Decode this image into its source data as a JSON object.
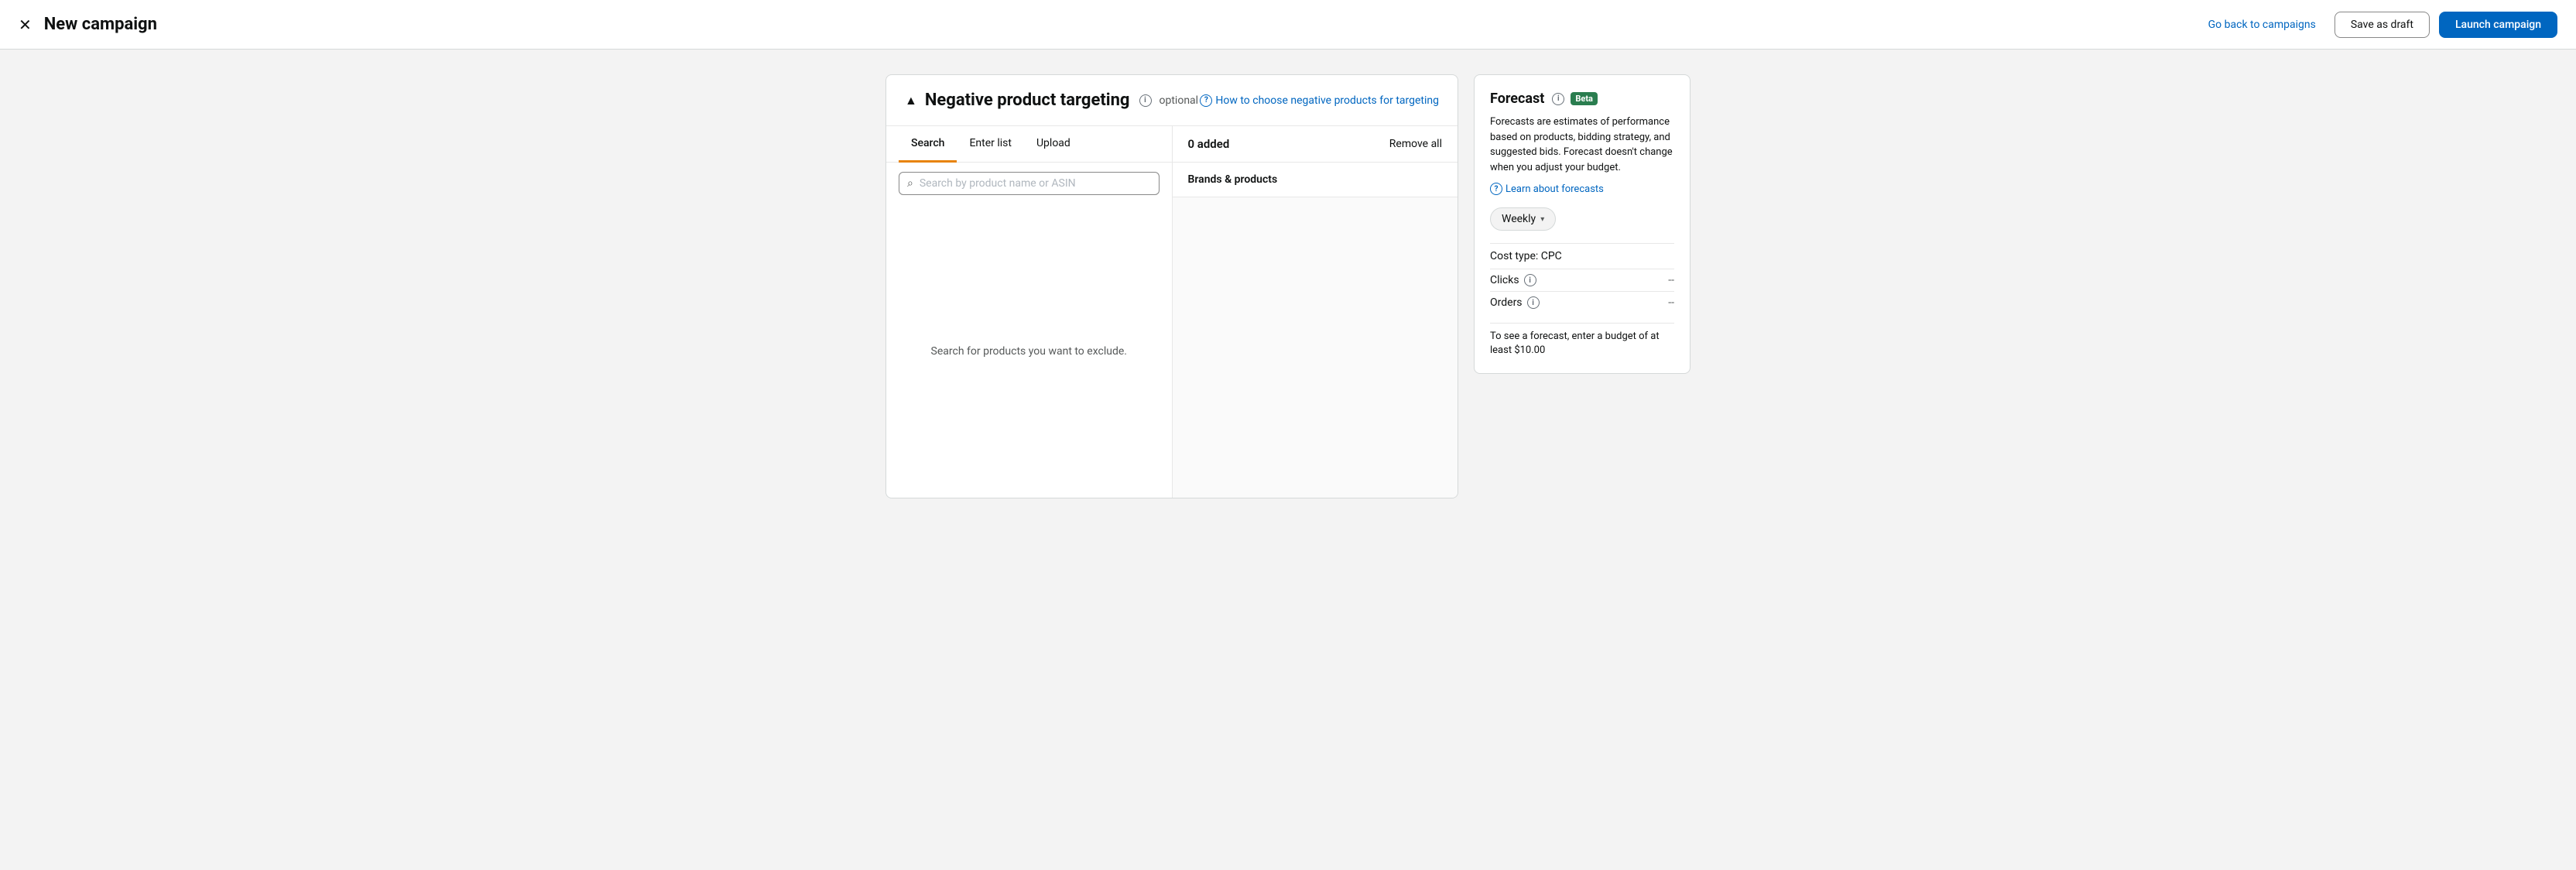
{
  "header": {
    "close_icon": "✕",
    "title": "New campaign",
    "go_back_label": "Go back to campaigns",
    "save_draft_label": "Save as draft",
    "launch_label": "Launch campaign"
  },
  "card": {
    "collapse_icon": "▲",
    "title": "Negative product targeting",
    "optional_label": "optional",
    "help_link_label": "How to choose negative products for targeting",
    "tabs": [
      {
        "label": "Search",
        "active": true
      },
      {
        "label": "Enter list",
        "active": false
      },
      {
        "label": "Upload",
        "active": false
      }
    ],
    "search_placeholder": "Search by product name or ASIN",
    "empty_state_text": "Search for products you want to exclude.",
    "right_panel": {
      "added_count": "0 added",
      "remove_all_label": "Remove all",
      "brands_title": "Brands & products"
    }
  },
  "forecast": {
    "title": "Forecast",
    "beta_label": "Beta",
    "description": "Forecasts are estimates of performance based on products, bidding strategy, and suggested bids. Forecast doesn't change when you adjust your budget.",
    "learn_link_label": "Learn about forecasts",
    "weekly_label": "Weekly",
    "cost_type_label": "Cost type: CPC",
    "clicks_label": "Clicks",
    "clicks_value": "--",
    "orders_label": "Orders",
    "orders_value": "--",
    "note_text": "To see a forecast, enter a budget of at least $10.00"
  }
}
